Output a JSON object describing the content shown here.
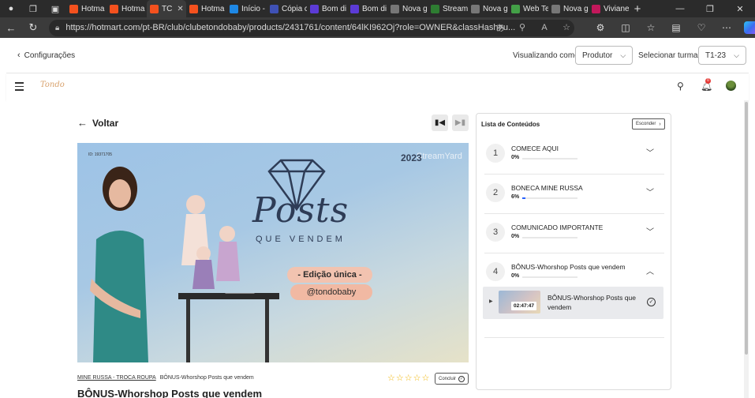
{
  "browser": {
    "tabs": [
      {
        "label": "Hotma",
        "color": "#f4511e"
      },
      {
        "label": "Hotma",
        "color": "#f4511e"
      },
      {
        "label": "TC",
        "color": "#f4511e",
        "active": true
      },
      {
        "label": "Hotma",
        "color": "#f4511e"
      },
      {
        "label": "Início -",
        "color": "#1e88e5"
      },
      {
        "label": "Cópia c",
        "color": "#3f51b5"
      },
      {
        "label": "Bom di",
        "color": "#5c3bd6"
      },
      {
        "label": "Bom di",
        "color": "#5c3bd6"
      },
      {
        "label": "Nova g",
        "color": "#777777"
      },
      {
        "label": "Stream",
        "color": "#2e7d32"
      },
      {
        "label": "Nova g",
        "color": "#777777"
      },
      {
        "label": "Web Te",
        "color": "#43a047"
      },
      {
        "label": "Nova g",
        "color": "#777777"
      },
      {
        "label": "Viviane",
        "color": "#c2185b"
      }
    ],
    "tab_close": "✕",
    "new_tab": "+",
    "url": "https://hotmart.com/pt-BR/club/clubetondobaby/products/2431761/content/64lKI962Oj?role=OWNER&classHash=u..."
  },
  "config": {
    "back_label": "Configurações",
    "viewing_label": "Visualizando como:",
    "viewing_value": "Produtor",
    "class_label": "Selecionar turma:",
    "class_value": "T1-23"
  },
  "header": {
    "logo_text": "Tondo",
    "notification_count": "0"
  },
  "player": {
    "back_label": "Voltar",
    "video": {
      "id_badge": "ID: 19371705",
      "year": "2023",
      "brand": "StreamYard",
      "title_main": "Posts",
      "title_sub": "QUE VENDEM",
      "edition": "- Edição única -",
      "handle": "@tondobaby"
    },
    "breadcrumb_module": "MINE RUSSA - TROCA ROUPA",
    "breadcrumb_lesson": "BÔNUS-Whorshop Posts que vendem",
    "stars": [
      "☆",
      "☆",
      "☆",
      "☆",
      "☆"
    ],
    "rating": 0,
    "complete_label": "Concluir",
    "lesson_title": "BÔNUS-Whorshop Posts que vendem"
  },
  "contents": {
    "title": "Lista de Conteúdos",
    "hide_label": "Esconder",
    "modules": [
      {
        "number": "1",
        "name": "COMECE AQUI",
        "percent_label": "0%",
        "progress": 0,
        "expanded": false
      },
      {
        "number": "2",
        "name": "BONECA MINE RUSSA",
        "percent_label": "6%",
        "progress": 0.06,
        "expanded": false
      },
      {
        "number": "3",
        "name": "COMUNICADO IMPORTANTE",
        "percent_label": "0%",
        "progress": 0,
        "expanded": false
      },
      {
        "number": "4",
        "name": "BÔNUS-Whorshop Posts que vendem",
        "percent_label": "0%",
        "progress": 0,
        "expanded": true
      }
    ],
    "lesson": {
      "duration": "02:47:47",
      "name": "BÔNUS-Whorshop Posts que vendem"
    }
  }
}
